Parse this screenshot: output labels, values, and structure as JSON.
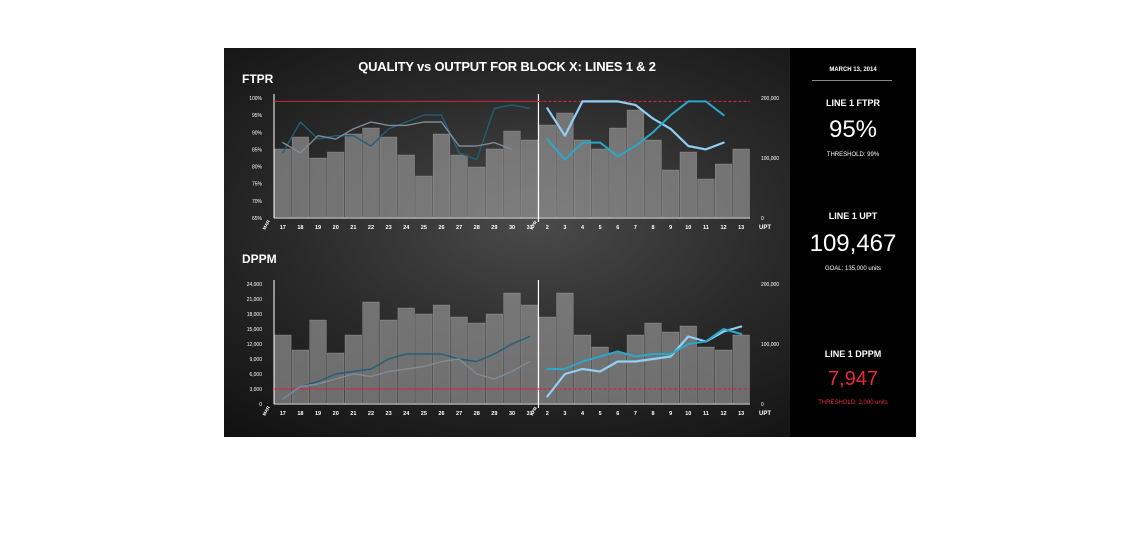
{
  "title": "QUALITY vs OUTPUT FOR BLOCK X:  LINES 1 & 2",
  "colors": {
    "line_light": "#8fd0f4",
    "line_teal": "#2aa7c9",
    "line_dark": "#1f5f78",
    "line_grey": "#7f8b95",
    "threshold": "#d0263a",
    "bar_fill": "#9a9a9a"
  },
  "sidebar": {
    "date": "MARCH 13, 2014",
    "kpis": [
      {
        "label": "LINE 1 FTPR",
        "value": "95%",
        "note": "THRESHOLD:  99%",
        "color": "#ffffff"
      },
      {
        "label": "LINE 1 UPT",
        "value": "109,467",
        "note": "GOAL: 135,000 units",
        "color": "#ffffff"
      },
      {
        "label": "LINE 1 DPPM",
        "value": "7,947",
        "note": "THRESHOLD: 3,000 units",
        "color": "#e8283c"
      }
    ]
  },
  "chart_data": [
    {
      "type": "bar",
      "title": "FTPR",
      "categories": [
        "17",
        "18",
        "19",
        "20",
        "21",
        "22",
        "23",
        "24",
        "25",
        "26",
        "27",
        "28",
        "29",
        "30",
        "31",
        "2",
        "3",
        "4",
        "5",
        "6",
        "7",
        "8",
        "9",
        "10",
        "11",
        "12",
        "13"
      ],
      "month_markers": [
        "MAR",
        "APR"
      ],
      "left_axis": {
        "ticks": [
          "100%",
          "95%",
          "90%",
          "85%",
          "80%",
          "75%",
          "70%",
          "65%"
        ],
        "range": [
          65,
          100
        ]
      },
      "right_axis": {
        "label": "UPT",
        "ticks": [
          "200,000",
          "100,000",
          "0"
        ],
        "range": [
          0,
          200000
        ]
      },
      "threshold": 99,
      "series": [
        {
          "values": [
            115000,
            135000,
            100000,
            110000,
            140000,
            150000,
            135000,
            105000,
            70000,
            140000,
            105000,
            85000,
            115000,
            145000,
            130000,
            155000,
            175000,
            130000,
            115000,
            150000,
            180000,
            130000,
            80000,
            110000,
            65000,
            90000,
            115000
          ]
        },
        {
          "values": [
            84,
            93,
            88,
            89,
            89,
            86,
            91,
            93,
            95,
            95,
            84,
            82,
            97,
            98,
            97,
            null,
            null,
            null,
            null,
            null,
            null,
            null,
            null,
            null,
            null,
            null,
            null
          ]
        },
        {
          "values": [
            87,
            84,
            89,
            88,
            91,
            93,
            92,
            92,
            93,
            93,
            86,
            86,
            87,
            85,
            null,
            null,
            null,
            null,
            null,
            null,
            null,
            null,
            null,
            null,
            null,
            null,
            null
          ]
        },
        {
          "values": [
            null,
            null,
            null,
            null,
            null,
            null,
            null,
            null,
            null,
            null,
            null,
            null,
            null,
            null,
            null,
            97,
            89,
            99,
            99,
            99,
            98,
            94,
            91,
            86,
            85,
            87,
            null
          ]
        },
        {
          "values": [
            null,
            null,
            null,
            null,
            null,
            null,
            null,
            null,
            null,
            null,
            null,
            null,
            null,
            null,
            null,
            88,
            82,
            87,
            87,
            83,
            86,
            90,
            95,
            99,
            99,
            95,
            null
          ]
        }
      ]
    },
    {
      "type": "bar",
      "title": "DPPM",
      "categories": [
        "17",
        "18",
        "19",
        "20",
        "21",
        "22",
        "23",
        "24",
        "25",
        "26",
        "27",
        "28",
        "29",
        "30",
        "31",
        "2",
        "3",
        "4",
        "5",
        "6",
        "7",
        "8",
        "9",
        "10",
        "11",
        "12",
        "13"
      ],
      "month_markers": [
        "MAR",
        "APR"
      ],
      "left_axis": {
        "ticks": [
          "24,000",
          "21,000",
          "18,000",
          "15,000",
          "12,000",
          "9,000",
          "6,000",
          "3,000",
          "0"
        ],
        "range": [
          0,
          24000
        ]
      },
      "right_axis": {
        "label": "UPT",
        "ticks": [
          "200,000",
          "100,000",
          "0"
        ],
        "range": [
          0,
          200000
        ]
      },
      "threshold": 3000,
      "series": [
        {
          "values": [
            115000,
            90000,
            140000,
            85000,
            115000,
            170000,
            140000,
            160000,
            150000,
            165000,
            145000,
            135000,
            150000,
            185000,
            165000,
            145000,
            185000,
            115000,
            95000,
            85000,
            115000,
            135000,
            120000,
            130000,
            95000,
            90000,
            115000
          ]
        },
        {
          "values": [
            1000,
            3500,
            4500,
            6000,
            6500,
            7000,
            9000,
            10000,
            10000,
            10000,
            9000,
            8500,
            10000,
            12000,
            13500,
            null,
            null,
            null,
            null,
            null,
            null,
            null,
            null,
            null,
            null,
            null,
            null
          ]
        },
        {
          "values": [
            1000,
            3500,
            4000,
            5000,
            6000,
            5500,
            6500,
            7000,
            7500,
            8500,
            9000,
            6000,
            5000,
            6500,
            8500,
            null,
            null,
            null,
            null,
            null,
            null,
            null,
            null,
            null,
            null,
            null,
            null
          ]
        },
        {
          "values": [
            null,
            null,
            null,
            null,
            null,
            null,
            null,
            null,
            null,
            null,
            null,
            null,
            null,
            null,
            null,
            1500,
            6000,
            7000,
            6500,
            8500,
            8500,
            9000,
            9500,
            13500,
            12500,
            14500,
            15500
          ]
        },
        {
          "values": [
            null,
            null,
            null,
            null,
            null,
            null,
            null,
            null,
            null,
            null,
            null,
            null,
            null,
            null,
            null,
            7000,
            7000,
            8500,
            9500,
            10500,
            9500,
            10000,
            10000,
            12000,
            12500,
            15000,
            14000
          ]
        }
      ]
    }
  ]
}
